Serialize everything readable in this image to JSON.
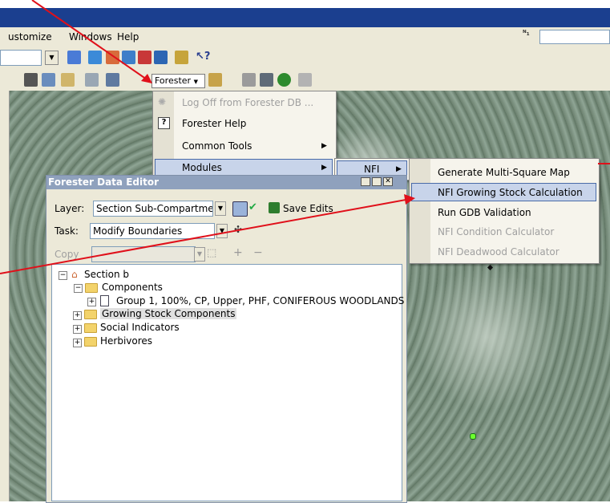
{
  "menubar": {
    "items": [
      "ustomize",
      "Windows",
      "Help"
    ]
  },
  "toolbar": {
    "forester_label": "Forester"
  },
  "forester_menu": {
    "items": [
      {
        "label": "Log Off from Forester DB ...",
        "enabled": false
      },
      {
        "label": "Forester Help",
        "enabled": true
      },
      {
        "label": "Common Tools",
        "enabled": true
      },
      {
        "label": "Modules",
        "enabled": true
      }
    ]
  },
  "modules_submenu": {
    "items": [
      {
        "label": "NFI"
      }
    ]
  },
  "nfi_submenu": {
    "items": [
      {
        "label": "Generate Multi-Square Map",
        "enabled": true
      },
      {
        "label": "NFI Growing Stock Calculation",
        "enabled": true,
        "highlighted": true
      },
      {
        "label": "Run GDB Validation",
        "enabled": true
      },
      {
        "label": "NFI Condition Calculator",
        "enabled": false
      },
      {
        "label": "NFI Deadwood Calculator",
        "enabled": false
      }
    ]
  },
  "editor": {
    "title": "Forester Data Editor",
    "layer_label": "Layer:",
    "layer_value": "Section Sub-Compartment",
    "save_edits": "Save Edits",
    "task_label": "Task:",
    "task_value": "Modify Boundaries",
    "copy_label": "Copy",
    "tree": {
      "root": "Section b",
      "components": "Components",
      "group": "Group 1, 100%, CP, Upper, PHF, CONIFEROUS WOODLANDS",
      "growing_stock": "Growing Stock Components",
      "social": "Social Indicators",
      "herbivores": "Herbivores"
    }
  },
  "colors": {
    "title_blue": "#1b3f8f",
    "annotation_red": "#e0101a",
    "highlight": "#c8d4ea"
  }
}
